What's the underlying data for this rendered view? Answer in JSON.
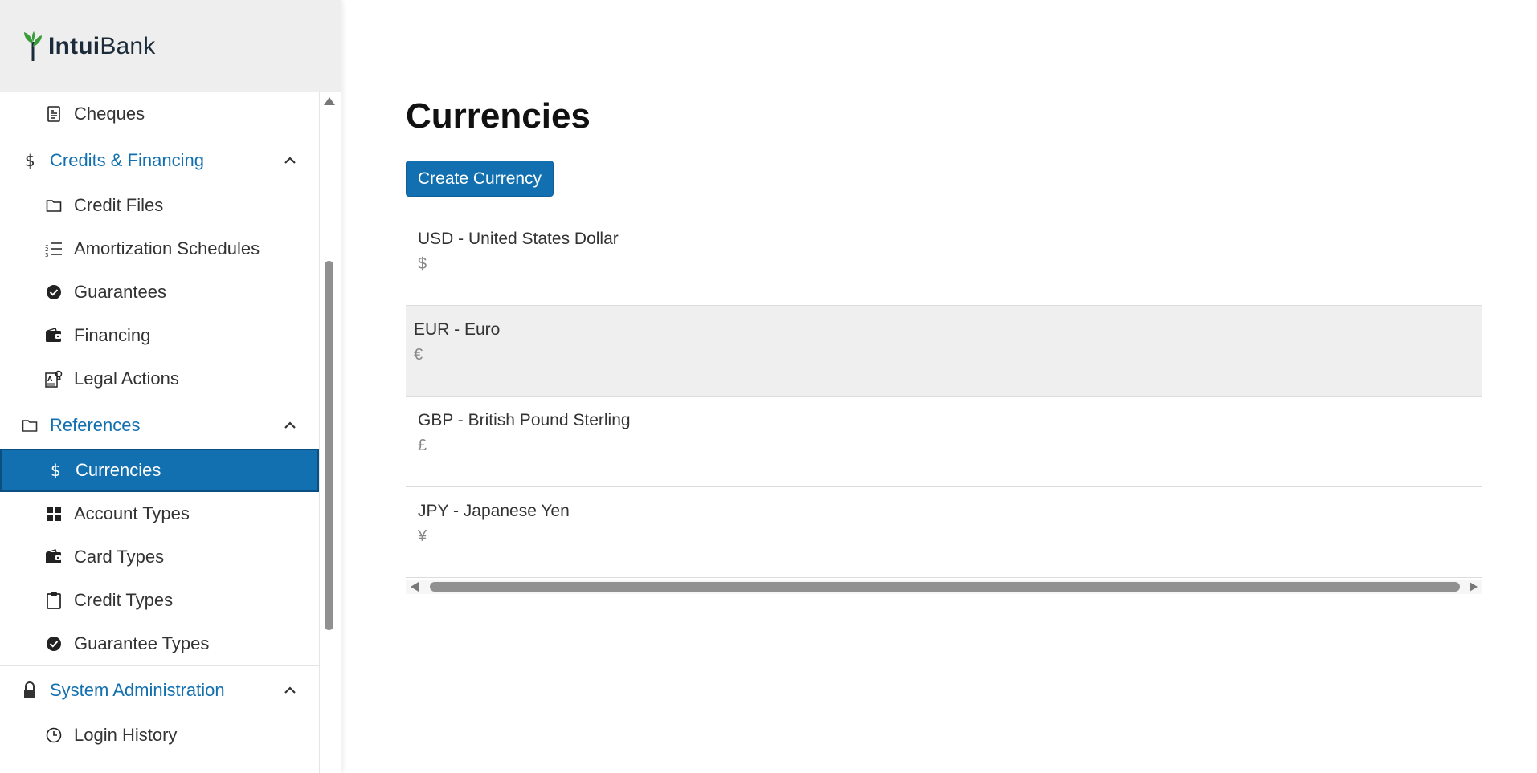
{
  "brand": {
    "name_bold": "Intui",
    "name_regular": "Bank"
  },
  "sidebar": {
    "top_items": [
      {
        "label": "Cheques",
        "icon": "cheque-icon"
      }
    ],
    "groups": [
      {
        "label": "Credits & Financing",
        "icon": "dollar-icon",
        "expanded": true,
        "items": [
          {
            "label": "Credit Files",
            "icon": "folder-icon"
          },
          {
            "label": "Amortization Schedules",
            "icon": "numbered-list-icon"
          },
          {
            "label": "Guarantees",
            "icon": "check-circle-icon"
          },
          {
            "label": "Financing",
            "icon": "wallet-icon"
          },
          {
            "label": "Legal Actions",
            "icon": "legal-document-icon"
          }
        ]
      },
      {
        "label": "References",
        "icon": "folder-icon",
        "expanded": true,
        "items": [
          {
            "label": "Currencies",
            "icon": "dollar-icon",
            "active": true
          },
          {
            "label": "Account Types",
            "icon": "grid-icon"
          },
          {
            "label": "Card Types",
            "icon": "wallet-icon"
          },
          {
            "label": "Credit Types",
            "icon": "clipboard-icon"
          },
          {
            "label": "Guarantee Types",
            "icon": "check-circle-icon"
          }
        ]
      },
      {
        "label": "System Administration",
        "icon": "lock-icon",
        "expanded": true,
        "items": [
          {
            "label": "Login History",
            "icon": "clock-icon"
          }
        ]
      }
    ]
  },
  "main": {
    "title": "Currencies",
    "create_button": "Create Currency",
    "currencies": [
      {
        "label": "USD - United States Dollar",
        "symbol": "$"
      },
      {
        "label": "EUR - Euro",
        "symbol": "€"
      },
      {
        "label": "GBP - British Pound Sterling",
        "symbol": "£"
      },
      {
        "label": "JPY - Japanese Yen",
        "symbol": "¥"
      }
    ]
  },
  "colors": {
    "accent": "#1270b0",
    "brand_leaf": "#3a9b3a",
    "brand_text": "#1c2b3a"
  }
}
